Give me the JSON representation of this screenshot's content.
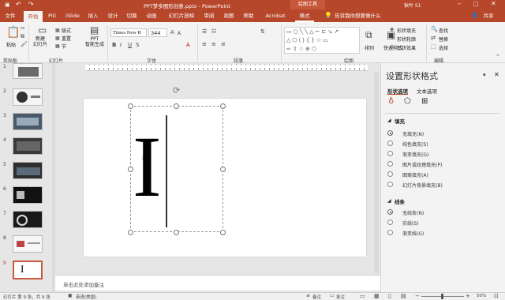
{
  "title": "PPT梦多图形创意.pptx - PowerPoint",
  "context_tools": "绘图工具",
  "user": "秋叶 S1",
  "tabs": [
    "文件",
    "开始",
    "Piti",
    "iSlide",
    "插入",
    "设计",
    "切换",
    "动画",
    "幻灯片放映",
    "审阅",
    "视图",
    "帮助",
    "Acrobat",
    "格式"
  ],
  "tell_me": "告诉我你想要做什么",
  "share": "共享",
  "ribbon": {
    "paste": "粘贴",
    "new_slide": "新建\n幻灯片",
    "layout": "版式",
    "reset": "重置",
    "section": "节",
    "ppt_gen": "PPT\n智能生成",
    "font_name": "Times New R",
    "font_size": "344",
    "arrange": "排列",
    "quick_styles": "快速样式",
    "shape_fill": "形状填充",
    "shape_outline": "形状轮廓",
    "shape_effects": "形状效果",
    "find": "查找",
    "replace": "替换",
    "select": "选择",
    "groups": [
      "剪贴板",
      "幻灯片",
      "字体",
      "段落",
      "绘图",
      "编辑"
    ]
  },
  "slides": [
    "1",
    "2",
    "3",
    "4",
    "5",
    "6",
    "7",
    "8",
    "9"
  ],
  "slide_letter": "I",
  "notes": "单击此处添加备注",
  "panel": {
    "title": "设置形状格式",
    "tab_shape": "形状选项",
    "tab_text": "文本选项",
    "fill_header": "填充",
    "fill_options": [
      "无填充(N)",
      "纯色填充(S)",
      "渐变填充(G)",
      "图片或纹理填充(P)",
      "图案填充(A)",
      "幻灯片背景填充(B)"
    ],
    "line_header": "线条",
    "line_options": [
      "无线条(N)",
      "实线(S)",
      "渐变线(G)"
    ]
  },
  "status": {
    "slide_info": "幻灯片 第 9 张，共 9 张",
    "language": "英语(美国)",
    "notes_btn": "备注",
    "comments_btn": "批注",
    "zoom": "50%"
  },
  "colors": {
    "accent": "#b7472a",
    "pane": "#f3f3f3"
  }
}
